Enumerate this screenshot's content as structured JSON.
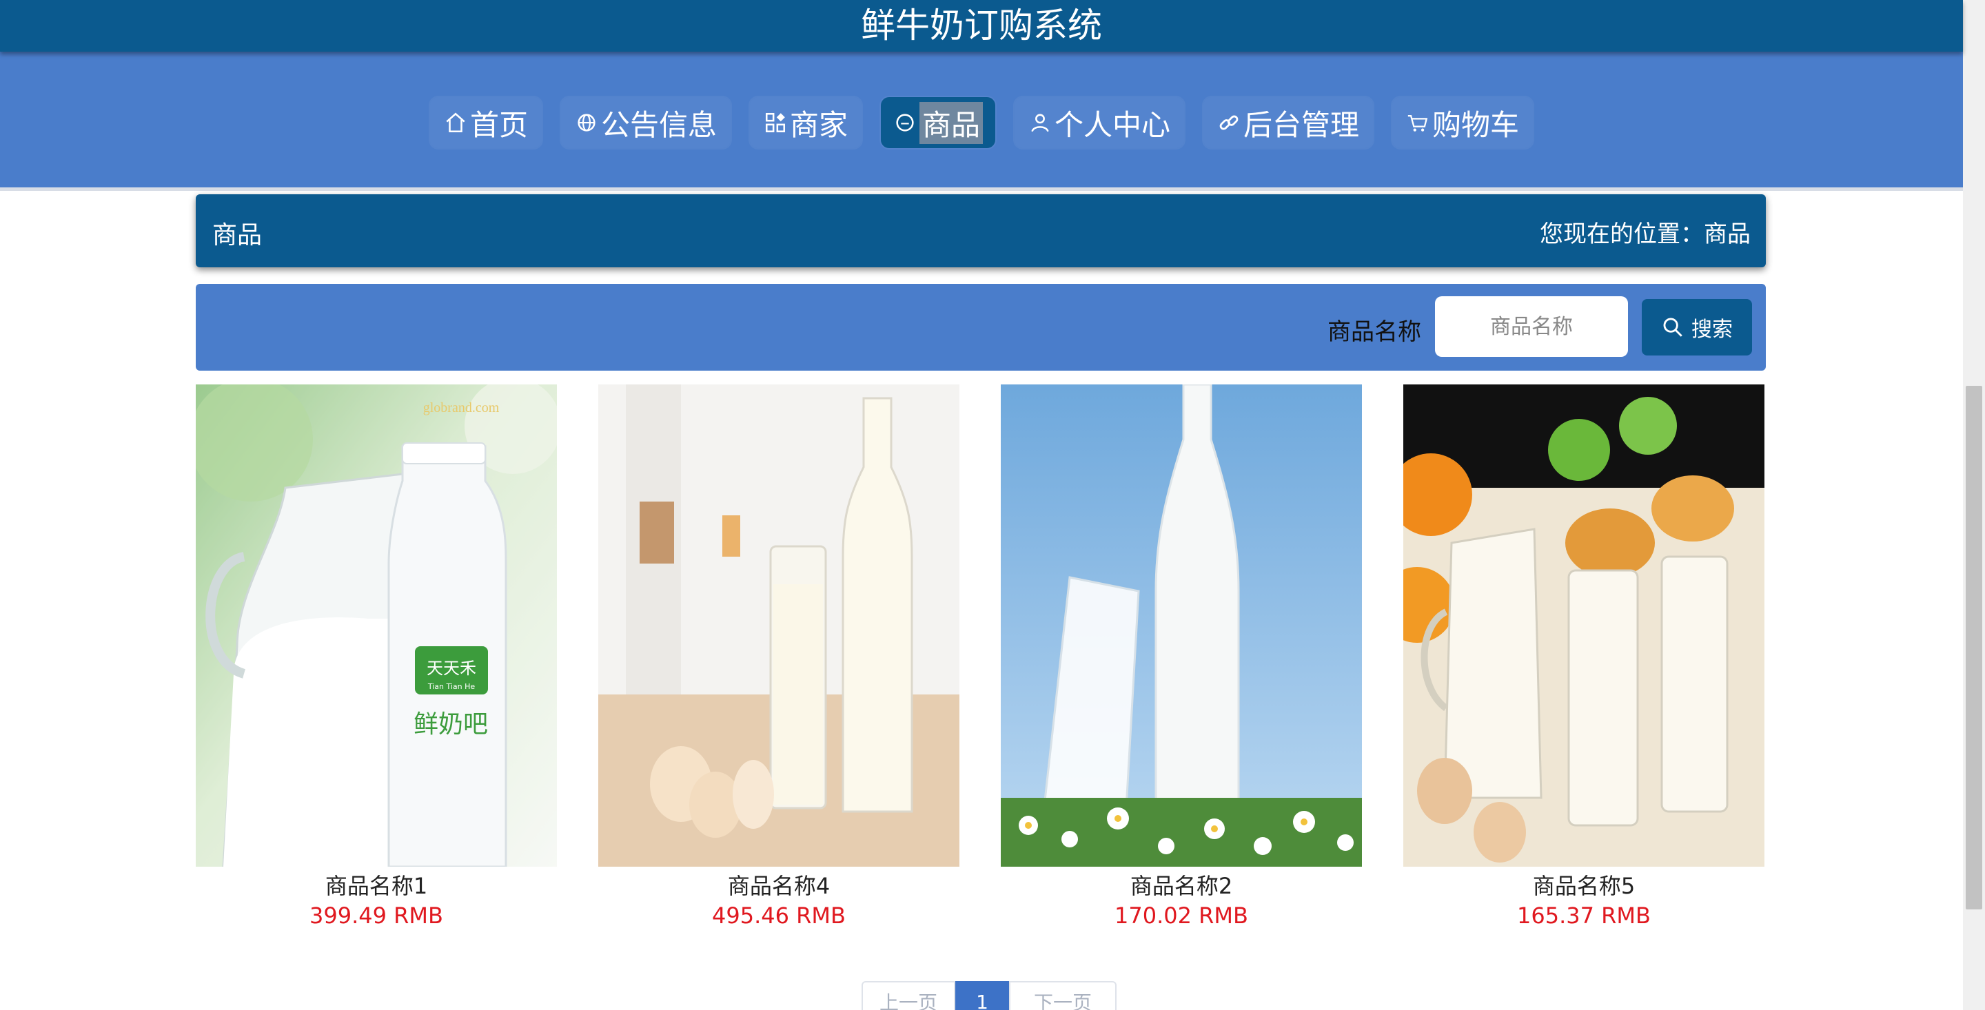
{
  "app": {
    "title": "鲜牛奶订购系统"
  },
  "nav": {
    "items": [
      {
        "label": "首页",
        "icon": "home-icon"
      },
      {
        "label": "公告信息",
        "icon": "globe-icon"
      },
      {
        "label": "商家",
        "icon": "grid-icon"
      },
      {
        "label": "商品",
        "icon": "circle-icon",
        "active": true
      },
      {
        "label": "个人中心",
        "icon": "user-icon"
      },
      {
        "label": "后台管理",
        "icon": "link-icon"
      },
      {
        "label": "购物车",
        "icon": "cart-icon"
      }
    ]
  },
  "breadcrumb": {
    "page_title": "商品",
    "location_text": "您现在的位置：商品"
  },
  "search": {
    "label": "商品名称",
    "placeholder": "商品名称",
    "button_label": "搜索"
  },
  "products": [
    {
      "name": "商品名称1",
      "price": "399.49 RMB"
    },
    {
      "name": "商品名称4",
      "price": "495.46 RMB"
    },
    {
      "name": "商品名称2",
      "price": "170.02 RMB"
    },
    {
      "name": "商品名称5",
      "price": "165.37 RMB"
    }
  ],
  "product_images": [
    {
      "watermark": "globrand.com",
      "bottle_label": "天天禾",
      "bottle_sub": "Tian Tian He",
      "bottle_text": "鲜奶吧"
    }
  ],
  "pagination": {
    "prev_label": "上一页",
    "current": "1",
    "next_label": "下一页"
  },
  "colors": {
    "header": "#0b5a8f",
    "nav_band": "#4a7dcb",
    "price": "#e0181f"
  }
}
